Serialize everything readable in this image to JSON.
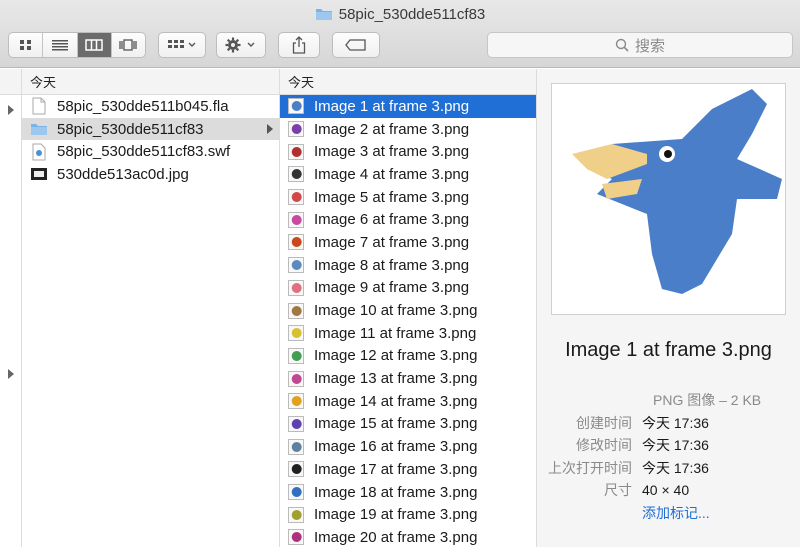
{
  "window": {
    "title": "58pic_530dde511cf83"
  },
  "toolbar": {
    "view_buttons": [
      "icon-view",
      "list-view",
      "column-view",
      "cover-flow-view"
    ],
    "search_placeholder": "搜索"
  },
  "columns": {
    "col2": {
      "header": "今天",
      "items": [
        {
          "label": "58pic_530dde511b045.fla",
          "icon": "document-icon"
        },
        {
          "label": "58pic_530dde511cf83",
          "icon": "folder-icon"
        },
        {
          "label": "58pic_530dde511cf83.swf",
          "icon": "swf-file-icon"
        },
        {
          "label": "530dde513ac0d.jpg",
          "icon": "image-file-icon"
        }
      ]
    },
    "col3": {
      "header": "今天",
      "items": [
        {
          "label": "Image 1 at frame 3.png",
          "color": "#4a7fc8"
        },
        {
          "label": "Image 2 at frame 3.png",
          "color": "#7a3fa8"
        },
        {
          "label": "Image 3 at frame 3.png",
          "color": "#b03030"
        },
        {
          "label": "Image 4 at frame 3.png",
          "color": "#333333"
        },
        {
          "label": "Image 5 at frame 3.png",
          "color": "#d04848"
        },
        {
          "label": "Image 6 at frame 3.png",
          "color": "#c84aa0"
        },
        {
          "label": "Image 7 at frame 3.png",
          "color": "#c84a1a"
        },
        {
          "label": "Image 8 at frame 3.png",
          "color": "#5a8ac0"
        },
        {
          "label": "Image 9 at frame 3.png",
          "color": "#e07080"
        },
        {
          "label": "Image 10 at frame 3.png",
          "color": "#a07840"
        },
        {
          "label": "Image 11 at frame 3.png",
          "color": "#d8c030"
        },
        {
          "label": "Image 12 at frame 3.png",
          "color": "#40a050"
        },
        {
          "label": "Image 13 at frame 3.png",
          "color": "#c04890"
        },
        {
          "label": "Image 14 at frame 3.png",
          "color": "#e0a020"
        },
        {
          "label": "Image 15 at frame 3.png",
          "color": "#6040b0"
        },
        {
          "label": "Image 16 at frame 3.png",
          "color": "#6080a0"
        },
        {
          "label": "Image 17 at frame 3.png",
          "color": "#202020"
        },
        {
          "label": "Image 18 at frame 3.png",
          "color": "#3070c0"
        },
        {
          "label": "Image 19 at frame 3.png",
          "color": "#a0a030"
        },
        {
          "label": "Image 20 at frame 3.png",
          "color": "#b03080"
        }
      ]
    }
  },
  "preview": {
    "name": "Image 1 at frame 3.png",
    "kind": "PNG 图像 – 2 KB",
    "fields": [
      {
        "label": "创建时间",
        "value": "今天 17:36"
      },
      {
        "label": "修改时间",
        "value": "今天 17:36"
      },
      {
        "label": "上次打开时间",
        "value": "今天 17:36"
      },
      {
        "label": "尺寸",
        "value": "40 × 40"
      }
    ],
    "add_tags": "添加标记..."
  },
  "colors": {
    "selection": "#1f6fd6",
    "folder": "#7ab3e8"
  }
}
